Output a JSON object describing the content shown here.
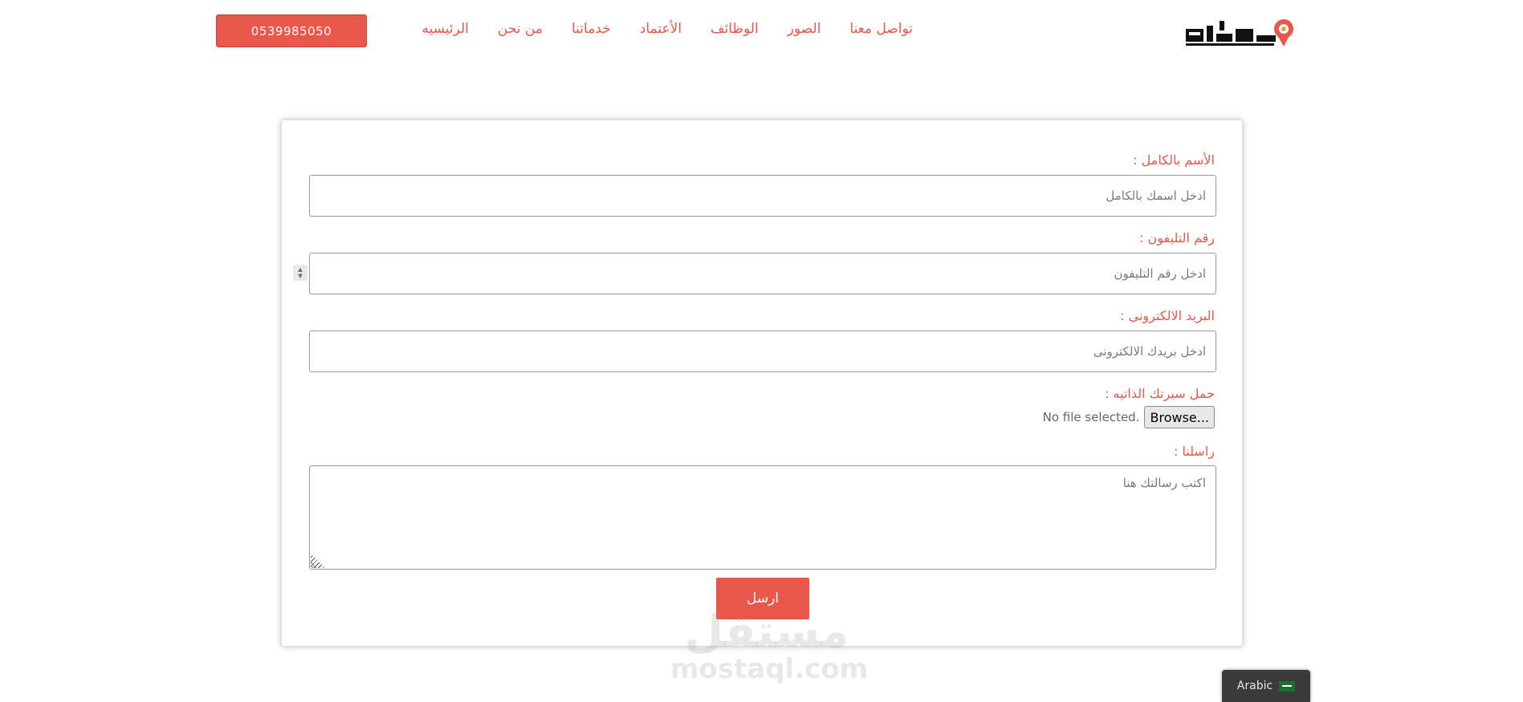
{
  "header": {
    "phone": "0539985050",
    "nav": [
      "الرئيسيه",
      "من نحن",
      "خدماتنا",
      "الأعتماد",
      "الوظائف",
      "الصور",
      "تواصل معنا"
    ]
  },
  "form": {
    "name_label": "الأسم بالكامل :",
    "name_placeholder": "ادخل اسمك بالكامل",
    "phone_label": "رقم التليفون :",
    "phone_placeholder": "ادخل رقم التليفون",
    "email_label": "البريد الالكترونى :",
    "email_placeholder": "ادخل بريدك الالكترونى",
    "cv_label": "حمل سيرتك الذاتيه :",
    "browse_label": "Browse...",
    "file_status": "No file selected.",
    "message_label": "راسلنا :",
    "message_placeholder": "اكتب رسالتك هنا",
    "submit_label": "ارسل"
  },
  "watermark": {
    "arabic": "مستقل",
    "latin": "mostaql.com"
  },
  "language": {
    "label": "Arabic"
  },
  "colors": {
    "accent": "#e8574a",
    "lang_bg": "#3a3a3a"
  }
}
